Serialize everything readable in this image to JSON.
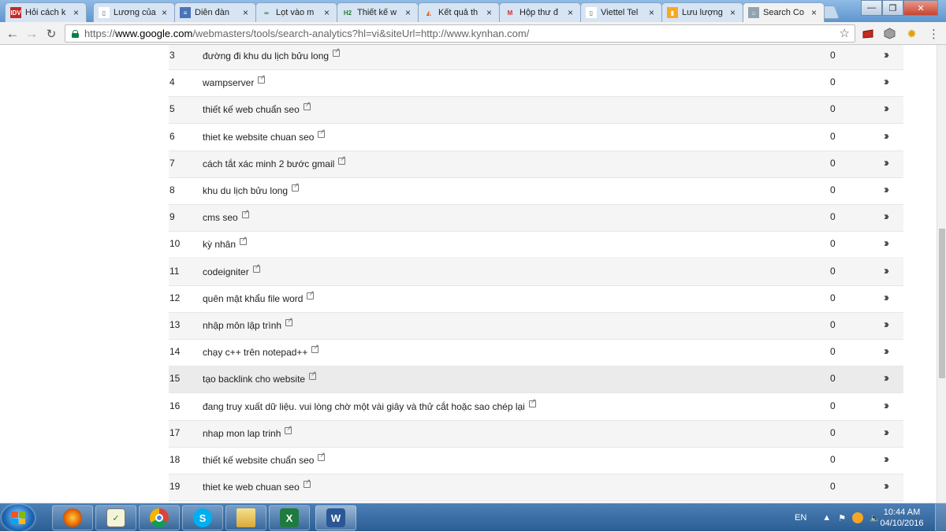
{
  "browser": {
    "tabs": [
      {
        "title": "Hỏi cách k",
        "favicon": "idv-icon"
      },
      {
        "title": "Lương của",
        "favicon": "document-icon"
      },
      {
        "title": "Diễn đàn",
        "favicon": "forum-icon"
      },
      {
        "title": "Lọt vào m",
        "favicon": "link-icon"
      },
      {
        "title": "Thiết kế w",
        "favicon": "h2-icon"
      },
      {
        "title": "Kết quả th",
        "favicon": "chart-icon"
      },
      {
        "title": "Hộp thư đ",
        "favicon": "gmail-icon"
      },
      {
        "title": "Viettel Tel",
        "favicon": "document-icon"
      },
      {
        "title": "Lưu lượng",
        "favicon": "analytics-icon"
      },
      {
        "title": "Search Co",
        "favicon": "search-console-icon"
      }
    ],
    "url": {
      "scheme": "https://",
      "host": "www.google.com",
      "path": "/webmasters/tools/search-analytics?hl=vi&siteUrl=http://www.kynhan.com/"
    }
  },
  "table": {
    "rows": [
      {
        "rank": "3",
        "query": "đường đi khu du lịch bửu long",
        "clicks": "0"
      },
      {
        "rank": "4",
        "query": "wampserver",
        "clicks": "0"
      },
      {
        "rank": "5",
        "query": "thiết kế web chuẩn seo",
        "clicks": "0"
      },
      {
        "rank": "6",
        "query": "thiet ke website chuan seo",
        "clicks": "0"
      },
      {
        "rank": "7",
        "query": "cách tắt xác minh 2 bước gmail",
        "clicks": "0"
      },
      {
        "rank": "8",
        "query": "khu du lịch bửu long",
        "clicks": "0"
      },
      {
        "rank": "9",
        "query": "cms seo",
        "clicks": "0"
      },
      {
        "rank": "10",
        "query": "kỳ nhân",
        "clicks": "0"
      },
      {
        "rank": "11",
        "query": "codeigniter",
        "clicks": "0"
      },
      {
        "rank": "12",
        "query": "quên mật khẩu file word",
        "clicks": "0"
      },
      {
        "rank": "13",
        "query": "nhập môn lập trình",
        "clicks": "0"
      },
      {
        "rank": "14",
        "query": "chạy c++ trên notepad++",
        "clicks": "0"
      },
      {
        "rank": "15",
        "query": "tạo backlink cho website",
        "clicks": "0"
      },
      {
        "rank": "16",
        "query": "đang truy xuất dữ liệu. vui lòng chờ một vài giây và thử cắt hoặc sao chép lại",
        "clicks": "0"
      },
      {
        "rank": "17",
        "query": "nhap mon lap trinh",
        "clicks": "0"
      },
      {
        "rank": "18",
        "query": "thiết kế website chuẩn seo",
        "clicks": "0"
      },
      {
        "rank": "19",
        "query": "thiet ke web chuan seo",
        "clicks": "0"
      }
    ]
  },
  "taskbar": {
    "apps": [
      "firefox-icon",
      "notepad-chart-icon",
      "chrome-icon",
      "skype-icon",
      "file-explorer-icon",
      "excel-icon",
      "word-icon"
    ],
    "language": "EN",
    "time": "10:44 AM",
    "date": "04/10/2016"
  }
}
